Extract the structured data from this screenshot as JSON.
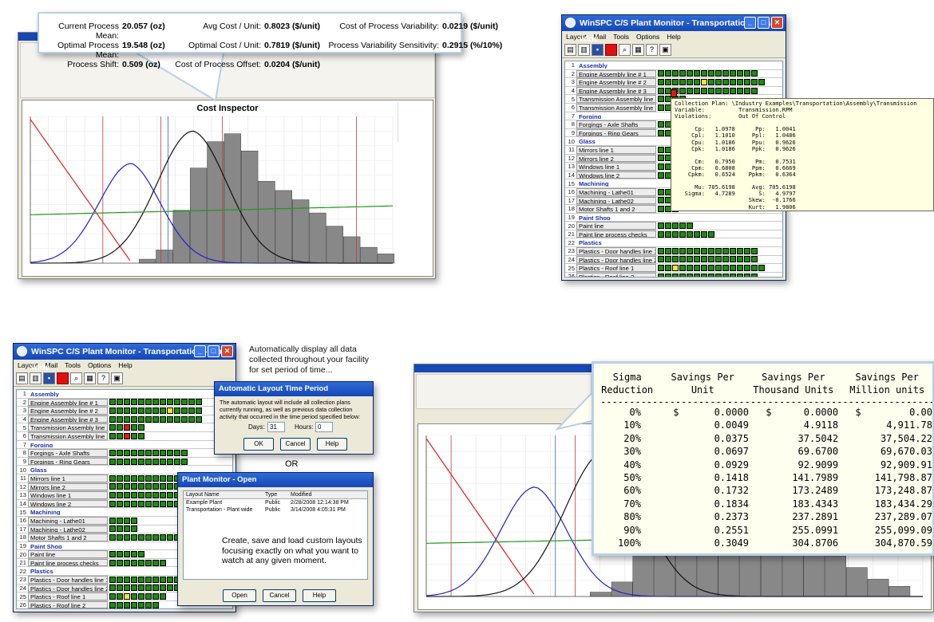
{
  "callout_top": {
    "current_process_mean_label": "Current Process Mean:",
    "current_process_mean_value": "20.057 (oz)",
    "optimal_process_mean_label": "Optimal Process Mean:",
    "optimal_process_mean_value": "19.548 (oz)",
    "process_shift_label": "Process Shift:",
    "process_shift_value": "0.509 (oz)",
    "avg_cost_label": "Avg Cost / Unit:",
    "avg_cost_value": "0.8023 ($/unit)",
    "optimal_cost_label": "Optimal Cost / Unit:",
    "optimal_cost_value": "0.7819 ($/unit)",
    "cost_offset_label": "Cost of Process Offset:",
    "cost_offset_value": "0.0204 ($/unit)",
    "cost_variability_label": "Cost of Process Variability:",
    "cost_variability_value": "0.0219 ($/unit)",
    "variability_sensitivity_label": "Process Variability Sensitivity:",
    "variability_sensitivity_value": "0.2915 (%/10%)"
  },
  "cost_chart": {
    "title": "Cost Inspector",
    "bars": [
      0.03,
      0.1,
      0.4,
      0.72,
      0.92,
      0.98,
      0.85,
      0.62,
      0.55,
      0.48,
      0.38,
      0.28,
      0.2,
      0.12,
      0.07
    ]
  },
  "monitor_top": {
    "title": "WinSPC C/S Plant Monitor - Transportation - Plant wide",
    "menu": [
      "Layout",
      "Mail",
      "Tools",
      "Options",
      "Help"
    ],
    "rows": [
      {
        "n": "1",
        "label": "Assembly",
        "section": true,
        "cells": ""
      },
      {
        "n": "2",
        "label": "Engine Assembly line # 1",
        "cells": "gggggggggggggg"
      },
      {
        "n": "3",
        "label": "Engine Assembly line # 2",
        "cells": "ggggggygggggggg"
      },
      {
        "n": "4",
        "label": "Engine Assembly line # 3",
        "cells": "gggggggggggggg"
      },
      {
        "n": "5",
        "label": "Transmission Assembly line 1",
        "cells": "gggg"
      },
      {
        "n": "6",
        "label": "Transmission Assembly line 2",
        "cells": "gggg"
      },
      {
        "n": "7",
        "label": "Forging",
        "section": true,
        "cells": ""
      },
      {
        "n": "8",
        "label": "Forgings - Axle Shafts",
        "cells": "ggg"
      },
      {
        "n": "9",
        "label": "Forgings - Ring Gears",
        "cells": "ggg"
      },
      {
        "n": "10",
        "label": "Glass",
        "section": true,
        "cells": ""
      },
      {
        "n": "11",
        "label": "Mirrors line 1",
        "cells": "ggg"
      },
      {
        "n": "12",
        "label": "Mirrors line 2",
        "cells": "ggg"
      },
      {
        "n": "13",
        "label": "Windows line 1",
        "cells": "ggg"
      },
      {
        "n": "14",
        "label": "Windows line 2",
        "cells": "ggg"
      },
      {
        "n": "15",
        "label": "Machining",
        "section": true,
        "cells": ""
      },
      {
        "n": "16",
        "label": "Machining - Lathe01",
        "cells": "ggg"
      },
      {
        "n": "17",
        "label": "Machining - Lathe02",
        "cells": "ggg"
      },
      {
        "n": "18",
        "label": "Motor Shafts 1 and 2",
        "cells": "ggg"
      },
      {
        "n": "19",
        "label": "Paint Shop",
        "section": true,
        "cells": ""
      },
      {
        "n": "20",
        "label": "Paint line",
        "cells": "ggggg"
      },
      {
        "n": "21",
        "label": "Paint line process checks",
        "cells": "gggggggg"
      },
      {
        "n": "22",
        "label": "Plastics",
        "section": true,
        "cells": ""
      },
      {
        "n": "23",
        "label": "Plastics - Door handles line 1",
        "cells": "gggggggggggggg"
      },
      {
        "n": "24",
        "label": "Plastics - Door handles line 2",
        "cells": "gggggggggggggg"
      },
      {
        "n": "25",
        "label": "Plastics - Roof line 1",
        "cells": "ggygggggggggggg"
      },
      {
        "n": "26",
        "label": "Plastics - Roof line 2",
        "cells": "gggggggggggggg"
      }
    ]
  },
  "tooltip_text": "Collection Plan: \\Industry Examples\\Transportation\\Assembly\\Transmission\nVariable:          Transmission.RPM\nViolations:        Out Of Control\n\n      Cp:   1.0978      Pp:   1.0041\n     Cpl:   1.1010     Ppl:   1.0486\n     Cpu:   1.0186     Ppu:   0.9626\n     Cpk:   1.0186     Ppk:   0.9626\n\n      Cm:   0.7950      Pm:   0.7531\n     Cpm:   0.6808     Ppm:   0.6669\n    Cpkm:   0.6524    Ppkm:   0.6364\n\n      Mu: 705.6198     Avg: 705.6198\n   Sigma:   4.7289       S:   4.9797\n                      Skew:  -0.1766\n                      Kurt:   1.9806",
  "monitor_bottom": {
    "title": "WinSPC C/S Plant Monitor - Transportation - Plant wide",
    "menu": [
      "Layout",
      "Mail",
      "Tools",
      "Options",
      "Help"
    ],
    "rows": [
      {
        "n": "1",
        "label": "Assembly",
        "section": true,
        "cells": ""
      },
      {
        "n": "2",
        "label": "Engine Assembly line # 1",
        "cells": "ggggggggggggg"
      },
      {
        "n": "3",
        "label": "Engine Assembly line # 2",
        "cells": "ggggggggygggg"
      },
      {
        "n": "4",
        "label": "Engine Assembly line # 3",
        "cells": "ggggggggggggg"
      },
      {
        "n": "5",
        "label": "Transmission Assembly line 1",
        "cells": "ggrgg"
      },
      {
        "n": "6",
        "label": "Transmission Assembly line 2",
        "cells": "ggrgg"
      },
      {
        "n": "7",
        "label": "Forging",
        "section": true,
        "cells": ""
      },
      {
        "n": "8",
        "label": "Forgings - Axle Shafts",
        "cells": "ggggggggggg"
      },
      {
        "n": "9",
        "label": "Forgings - Ring Gears",
        "cells": "ggggggggggg"
      },
      {
        "n": "10",
        "label": "Glass",
        "section": true,
        "cells": ""
      },
      {
        "n": "11",
        "label": "Mirrors line 1",
        "cells": "gggggggggggg"
      },
      {
        "n": "12",
        "label": "Mirrors line 2",
        "cells": "gggggggggggg"
      },
      {
        "n": "13",
        "label": "Windows line 1",
        "cells": "gggggggggggg"
      },
      {
        "n": "14",
        "label": "Windows line 2",
        "cells": "gggggggggggg"
      },
      {
        "n": "15",
        "label": "Machining",
        "section": true,
        "cells": ""
      },
      {
        "n": "16",
        "label": "Machining - Lathe01",
        "cells": "gggg"
      },
      {
        "n": "17",
        "label": "Machining - Lathe02",
        "cells": "gggg"
      },
      {
        "n": "18",
        "label": "Motor Shafts 1 and 2",
        "cells": "gggggggggggg"
      },
      {
        "n": "19",
        "label": "Paint Shop",
        "section": true,
        "cells": ""
      },
      {
        "n": "20",
        "label": "Paint line",
        "cells": "ggggg"
      },
      {
        "n": "21",
        "label": "Paint line process checks",
        "cells": "gggggggg"
      },
      {
        "n": "22",
        "label": "Plastics",
        "section": true,
        "cells": ""
      },
      {
        "n": "23",
        "label": "Plastics - Door handles line 1",
        "cells": "ggggggggggggg"
      },
      {
        "n": "24",
        "label": "Plastics - Door handles line 2",
        "cells": "ggggggggggggg"
      },
      {
        "n": "25",
        "label": "Plastics - Roof line 1",
        "cells": "ggyggggg"
      },
      {
        "n": "26",
        "label": "Plastics - Roof line 2",
        "cells": "ggggggg"
      }
    ]
  },
  "caption_top": "Automatically display all data collected throughout your facility for set period of time...",
  "time_dialog": {
    "title": "Automatic Layout Time Period",
    "text": "The automatic layout will include all collection plans currently running, as well as previous data collection activity that occurred in the time period specified below:",
    "days_label": "Days:",
    "days_value": "31",
    "hours_label": "Hours:",
    "hours_value": "0",
    "ok": "OK",
    "cancel": "Cancel",
    "help": "Help"
  },
  "or_text": "OR",
  "open_dialog": {
    "title": "Plant Monitor - Open",
    "col_name": "Layout Name",
    "col_type": "Type",
    "col_modified": "Modified",
    "rows": [
      {
        "name": "Example Plant",
        "type": "Public",
        "modified": "2/28/2008 12:14:38 PM"
      },
      {
        "name": "Transportation - Plant wide",
        "type": "Public",
        "modified": "3/14/2008 4:05:31 PM"
      }
    ],
    "caption": "Create, save and load custom layouts focusing exactly on what you want to watch at any given moment.",
    "open": "Open",
    "cancel": "Cancel",
    "help": "Help"
  },
  "savings": {
    "h1a": "Sigma",
    "h1b": "Reduction",
    "h2a": "Savings Per",
    "h2b": "Unit",
    "h3a": "Savings Per",
    "h3b": "Thousand Units",
    "h4a": "Savings Per",
    "h4b": "Million units",
    "dashes": "---------------------------------------------------------------",
    "rows": [
      {
        "p": "0%",
        "d": "$",
        "u": "0.0000",
        "t": "0.0000",
        "m": "0.00"
      },
      {
        "p": "10%",
        "d": "",
        "u": "0.0049",
        "t": "4.9118",
        "m": "4,911.78"
      },
      {
        "p": "20%",
        "d": "",
        "u": "0.0375",
        "t": "37.5042",
        "m": "37,504.22"
      },
      {
        "p": "30%",
        "d": "",
        "u": "0.0697",
        "t": "69.6700",
        "m": "69,670.03"
      },
      {
        "p": "40%",
        "d": "",
        "u": "0.0929",
        "t": "92.9099",
        "m": "92,909.91"
      },
      {
        "p": "50%",
        "d": "",
        "u": "0.1418",
        "t": "141.7989",
        "m": "141,798.87"
      },
      {
        "p": "60%",
        "d": "",
        "u": "0.1732",
        "t": "173.2489",
        "m": "173,248.87"
      },
      {
        "p": "70%",
        "d": "",
        "u": "0.1834",
        "t": "183.4343",
        "m": "183,434.29"
      },
      {
        "p": "80%",
        "d": "",
        "u": "0.2373",
        "t": "237.2891",
        "m": "237,289.07"
      },
      {
        "p": "90%",
        "d": "",
        "u": "0.2551",
        "t": "255.0991",
        "m": "255,099.09"
      },
      {
        "p": "100%",
        "d": "",
        "u": "0.3049",
        "t": "304.8706",
        "m": "304,870.59"
      }
    ]
  },
  "colors": {
    "title_blue": "#1547b5",
    "cell_green": "#1f8a12",
    "cell_yellow": "#f0e33a",
    "cell_red": "#e01818",
    "section_blue": "#1a2fa8"
  }
}
